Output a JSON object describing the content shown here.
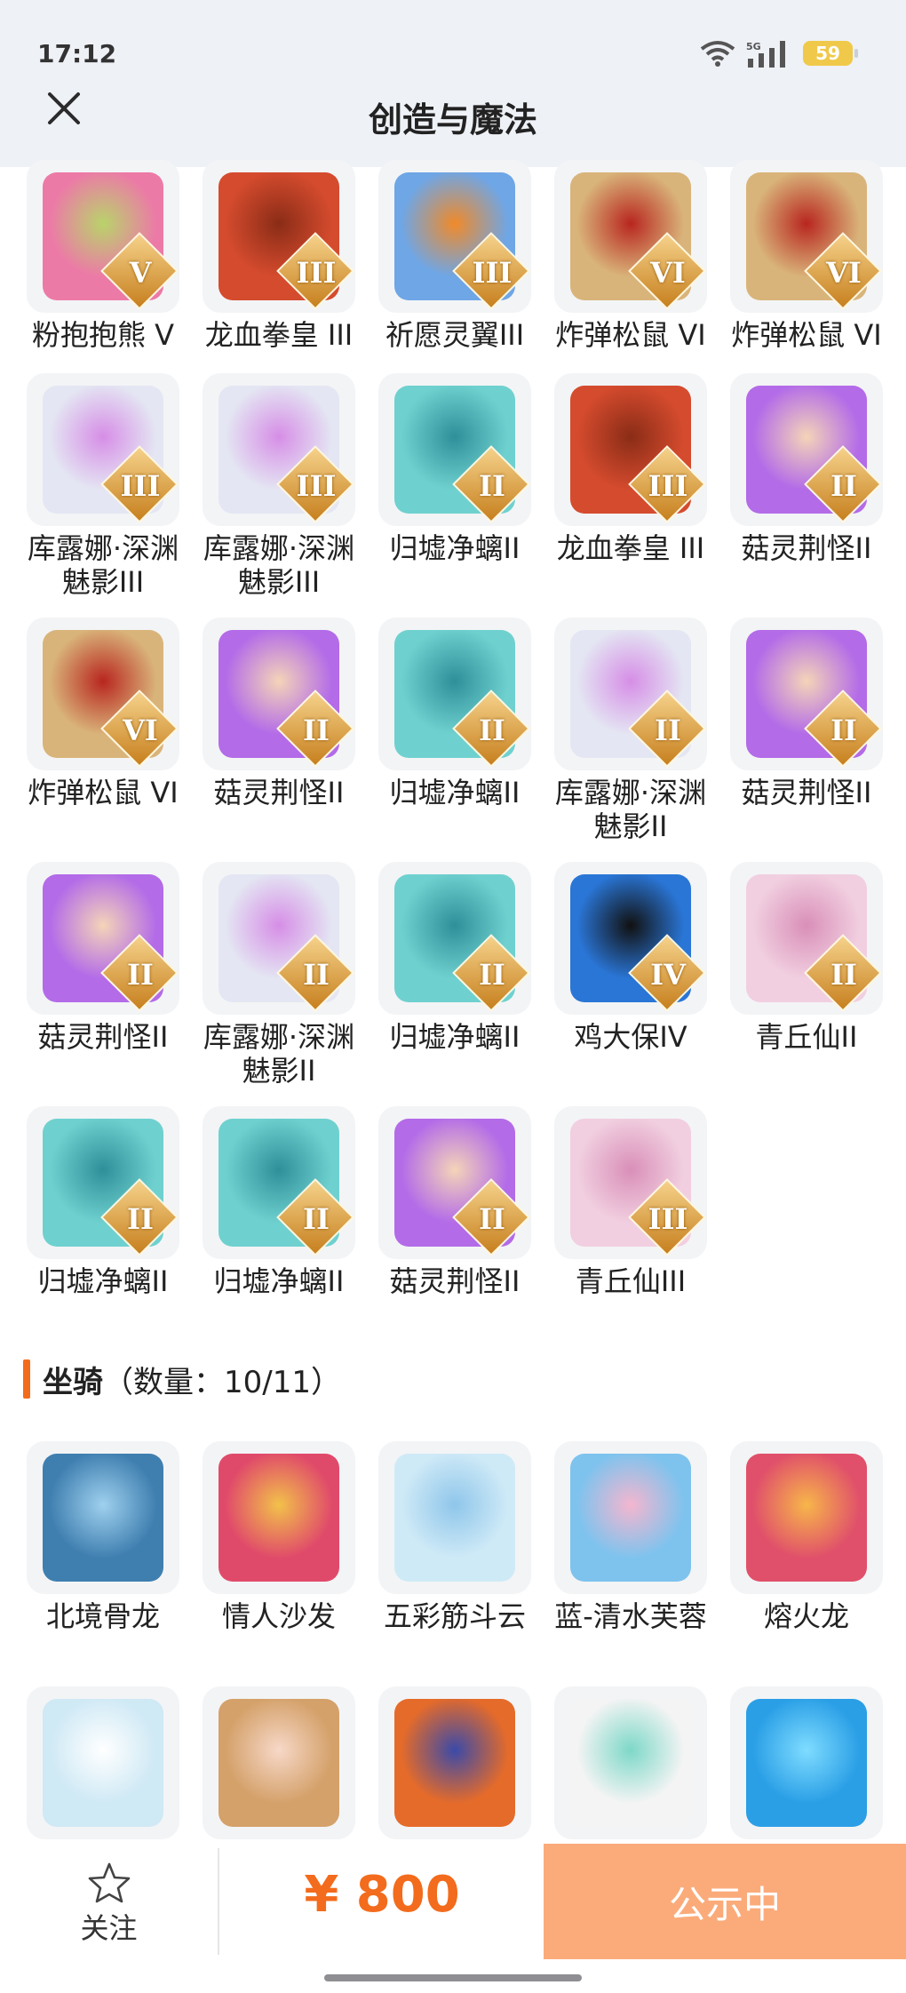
{
  "status": {
    "time": "17:12",
    "network": "5G",
    "battery": "59"
  },
  "nav": {
    "title": "创造与魔法"
  },
  "pets": [
    {
      "name": "粉抱抱熊 V",
      "tier": "V",
      "color": "#ec7aa7",
      "accent": "#b9d36a",
      "icon": "bear-icon"
    },
    {
      "name": "龙血拳皇 III",
      "tier": "III",
      "color": "#d54b2e",
      "accent": "#8a2c16",
      "icon": "dragon-warrior-icon"
    },
    {
      "name": "祈愿灵翼III",
      "tier": "III",
      "color": "#6ea6e6",
      "accent": "#f08a2a",
      "icon": "eagle-icon"
    },
    {
      "name": "炸弹松鼠 VI",
      "tier": "VI",
      "color": "#d9b47a",
      "accent": "#b8261f",
      "icon": "squirrel-icon"
    },
    {
      "name": "炸弹松鼠 VI",
      "tier": "VI",
      "color": "#d9b47a",
      "accent": "#b8261f",
      "icon": "squirrel-icon"
    },
    {
      "name": "库露娜·深渊魅影III",
      "tier": "III",
      "color": "#e4e6f3",
      "accent": "#d68ee6",
      "icon": "lady-icon"
    },
    {
      "name": "库露娜·深渊魅影III",
      "tier": "III",
      "color": "#e4e6f3",
      "accent": "#d68ee6",
      "icon": "lady-icon"
    },
    {
      "name": "归墟净螭II",
      "tier": "II",
      "color": "#6fd1cf",
      "accent": "#2f8f9a",
      "icon": "sea-dragon-icon"
    },
    {
      "name": "龙血拳皇 III",
      "tier": "III",
      "color": "#d54b2e",
      "accent": "#8a2c16",
      "icon": "dragon-warrior-icon"
    },
    {
      "name": "菇灵荆怪II",
      "tier": "II",
      "color": "#b36be8",
      "accent": "#f4d4b8",
      "icon": "mushroom-icon"
    },
    {
      "name": "炸弹松鼠 VI",
      "tier": "VI",
      "color": "#d9b47a",
      "accent": "#b8261f",
      "icon": "squirrel-icon"
    },
    {
      "name": "菇灵荆怪II",
      "tier": "II",
      "color": "#b36be8",
      "accent": "#f4d4b8",
      "icon": "mushroom-icon"
    },
    {
      "name": "归墟净螭II",
      "tier": "II",
      "color": "#6fd1cf",
      "accent": "#2f8f9a",
      "icon": "sea-dragon-icon"
    },
    {
      "name": "库露娜·深渊魅影II",
      "tier": "II",
      "color": "#e4e6f3",
      "accent": "#d68ee6",
      "icon": "lady-icon"
    },
    {
      "name": "菇灵荆怪II",
      "tier": "II",
      "color": "#b36be8",
      "accent": "#f4d4b8",
      "icon": "mushroom-icon"
    },
    {
      "name": "菇灵荆怪II",
      "tier": "II",
      "color": "#b36be8",
      "accent": "#f4d4b8",
      "icon": "mushroom-icon"
    },
    {
      "name": "库露娜·深渊魅影II",
      "tier": "II",
      "color": "#e4e6f3",
      "accent": "#d68ee6",
      "icon": "lady-icon"
    },
    {
      "name": "归墟净螭II",
      "tier": "II",
      "color": "#6fd1cf",
      "accent": "#2f8f9a",
      "icon": "sea-dragon-icon"
    },
    {
      "name": "鸡大保IV",
      "tier": "IV",
      "color": "#2a76d6",
      "accent": "#111111",
      "icon": "bird-icon"
    },
    {
      "name": "青丘仙II",
      "tier": "II",
      "color": "#f1cfe0",
      "accent": "#d98fb8",
      "icon": "fox-fairy-icon"
    },
    {
      "name": "归墟净螭II",
      "tier": "II",
      "color": "#6fd1cf",
      "accent": "#2f8f9a",
      "icon": "sea-dragon-icon"
    },
    {
      "name": "归墟净螭II",
      "tier": "II",
      "color": "#6fd1cf",
      "accent": "#2f8f9a",
      "icon": "sea-dragon-icon"
    },
    {
      "name": "菇灵荆怪II",
      "tier": "II",
      "color": "#b36be8",
      "accent": "#f4d4b8",
      "icon": "mushroom-icon"
    },
    {
      "name": "青丘仙III",
      "tier": "III",
      "color": "#f1cfe0",
      "accent": "#d98fb8",
      "icon": "fox-fairy-icon"
    }
  ],
  "mounts_section": {
    "title": "坐骑",
    "count": "（数量：10/11）"
  },
  "mounts": [
    {
      "name": "北境骨龙",
      "color": "#3f7fb0",
      "accent": "#9fd0ee",
      "icon": "bone-dragon-icon"
    },
    {
      "name": "情人沙发",
      "color": "#e04a6a",
      "accent": "#f2c14a",
      "icon": "sofa-icon"
    },
    {
      "name": "五彩筋斗云",
      "color": "#cfeaf7",
      "accent": "#8fc6ea",
      "icon": "cloud-icon"
    },
    {
      "name": "蓝-清水芙蓉",
      "color": "#7ec3ee",
      "accent": "#f4b6cf",
      "icon": "lotus-icon"
    },
    {
      "name": "熔火龙",
      "color": "#e0506a",
      "accent": "#f7b64a",
      "icon": "lava-dragon-icon"
    },
    {
      "name": "",
      "color": "#cfe9f5",
      "accent": "#ffffff",
      "icon": "skateboard-icon"
    },
    {
      "name": "",
      "color": "#d4a16a",
      "accent": "#f7d8c8",
      "icon": "deer-icon"
    },
    {
      "name": "",
      "color": "#e56b2a",
      "accent": "#3b4aa8",
      "icon": "phoenix-icon"
    },
    {
      "name": "",
      "color": "#f4f4f4",
      "accent": "#7dd8c8",
      "icon": "white-fox-icon"
    },
    {
      "name": "",
      "color": "#2a9fe6",
      "accent": "#7fdcff",
      "icon": "crystal-icon"
    }
  ],
  "bottom": {
    "follow_label": "关注",
    "price": "¥ 800",
    "status_label": "公示中"
  }
}
